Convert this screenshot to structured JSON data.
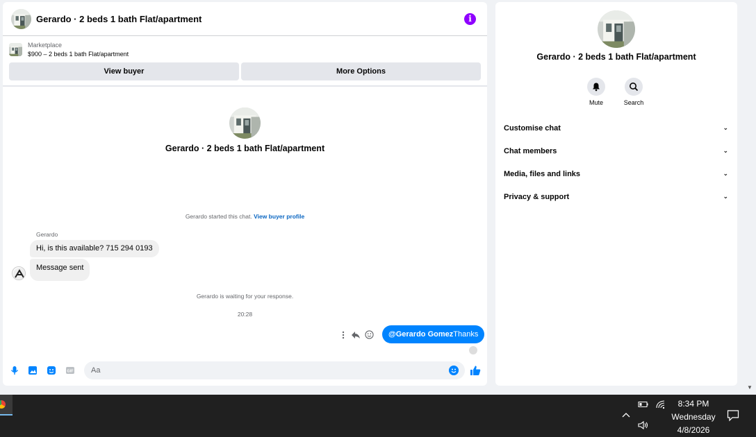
{
  "chat_header": {
    "title": "Gerardo · 2 beds 1 bath Flat/apartment",
    "info_icon": "info-icon"
  },
  "marketplace": {
    "kicker": "Marketplace",
    "listing": "$900 – 2 beds 1 bath Flat/apartment",
    "view_buyer": "View buyer",
    "more_options": "More Options"
  },
  "conversation": {
    "title": "Gerardo · 2 beds 1 bath Flat/apartment",
    "started_note": "Gerardo started this chat.",
    "buyer_profile_link": "View buyer profile",
    "sender_name": "Gerardo",
    "incoming": [
      "Hi, is this available? 715 294 0193",
      "Message sent"
    ],
    "waiting_note": "Gerardo is waiting for your response.",
    "timestamp": "20:28",
    "outgoing_mention": "@Gerardo Gomez",
    "outgoing_text": "Thanks"
  },
  "composer": {
    "placeholder": "Aa"
  },
  "right_panel": {
    "title": "Gerardo · 2 beds 1 bath Flat/apartment",
    "mute": "Mute",
    "search": "Search",
    "sections": [
      "Customise chat",
      "Chat members",
      "Media, files and links",
      "Privacy & support"
    ]
  },
  "taskbar": {
    "time": "8:34 PM",
    "day": "Wednesday",
    "date": "4/8/2026"
  },
  "colors": {
    "accent": "#0084ff",
    "info": "#8f00ff",
    "taskbar": "#202020"
  }
}
